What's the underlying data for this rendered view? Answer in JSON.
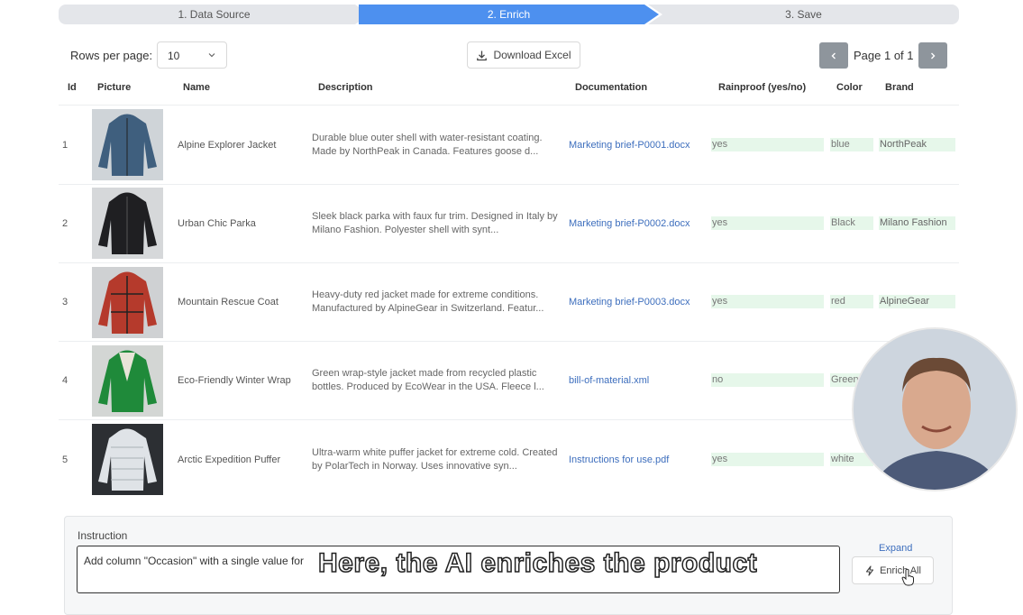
{
  "stepper": {
    "steps": [
      {
        "label": "1. Data Source"
      },
      {
        "label": "2. Enrich"
      },
      {
        "label": "3. Save"
      }
    ]
  },
  "toolbar": {
    "rows_per_page_label": "Rows per page:",
    "rows_per_page_value": "10",
    "download_label": "Download Excel",
    "page_text": "Page 1 of 1"
  },
  "table": {
    "headers": [
      "Id",
      "Picture",
      "Name",
      "Description",
      "Documentation",
      "Rainproof (yes/no)",
      "Color",
      "Brand"
    ],
    "rows": [
      {
        "id": "1",
        "name": "Alpine Explorer Jacket",
        "desc1": "Durable blue outer shell with water-resistant coating.",
        "desc2": "Made by NorthPeak in Canada. Features goose d...",
        "doc": "Marketing brief-P0001.docx",
        "rain": "yes",
        "color": "blue",
        "brand": "NorthPeak",
        "jacket_color": "#3f5f7e"
      },
      {
        "id": "2",
        "name": "Urban Chic Parka",
        "desc1": "Sleek black parka with faux fur trim. Designed in Italy by",
        "desc2": "Milano Fashion. Polyester shell with synt...",
        "doc": "Marketing brief-P0002.docx",
        "rain": "yes",
        "color": "Black",
        "brand": "Milano Fashion",
        "jacket_color": "#1f1f22"
      },
      {
        "id": "3",
        "name": "Mountain Rescue Coat",
        "desc1": "Heavy-duty red jacket made for extreme conditions.",
        "desc2": "Manufactured by AlpineGear in Switzerland. Featur...",
        "doc": "Marketing brief-P0003.docx",
        "rain": "yes",
        "color": "red",
        "brand": "AlpineGear",
        "jacket_color": "#b53a2c"
      },
      {
        "id": "4",
        "name": "Eco-Friendly Winter Wrap",
        "desc1": "Green wrap-style jacket made from recycled plastic",
        "desc2": "bottles. Produced by EcoWear in the USA. Fleece l...",
        "doc": "bill-of-material.xml",
        "rain": "no",
        "color": "Green",
        "brand": "",
        "jacket_color": "#1f8a3a"
      },
      {
        "id": "5",
        "name": "Arctic Expedition Puffer",
        "desc1": "Ultra-warm white puffer jacket for extreme cold. Created",
        "desc2": "by PolarTech in Norway. Uses innovative syn...",
        "doc": "Instructions for use.pdf",
        "rain": "yes",
        "color": "white",
        "brand": "",
        "jacket_color": "#dfe3e7"
      }
    ]
  },
  "instruction": {
    "label": "Instruction",
    "value": "Add column \"Occasion\" with a single value for",
    "expand_label": "Expand",
    "enrich_label": "Enrich All"
  },
  "caption": "Here, the AI enriches the product",
  "icons": {
    "download": "download-icon",
    "prev": "chevron-left-icon",
    "next": "chevron-right-icon",
    "select": "chevron-down-icon",
    "enrich": "lightning-icon"
  },
  "colors": {
    "active_step": "#4d90ef",
    "link": "#3d6ebd",
    "highlight": "#e6f7ea"
  }
}
